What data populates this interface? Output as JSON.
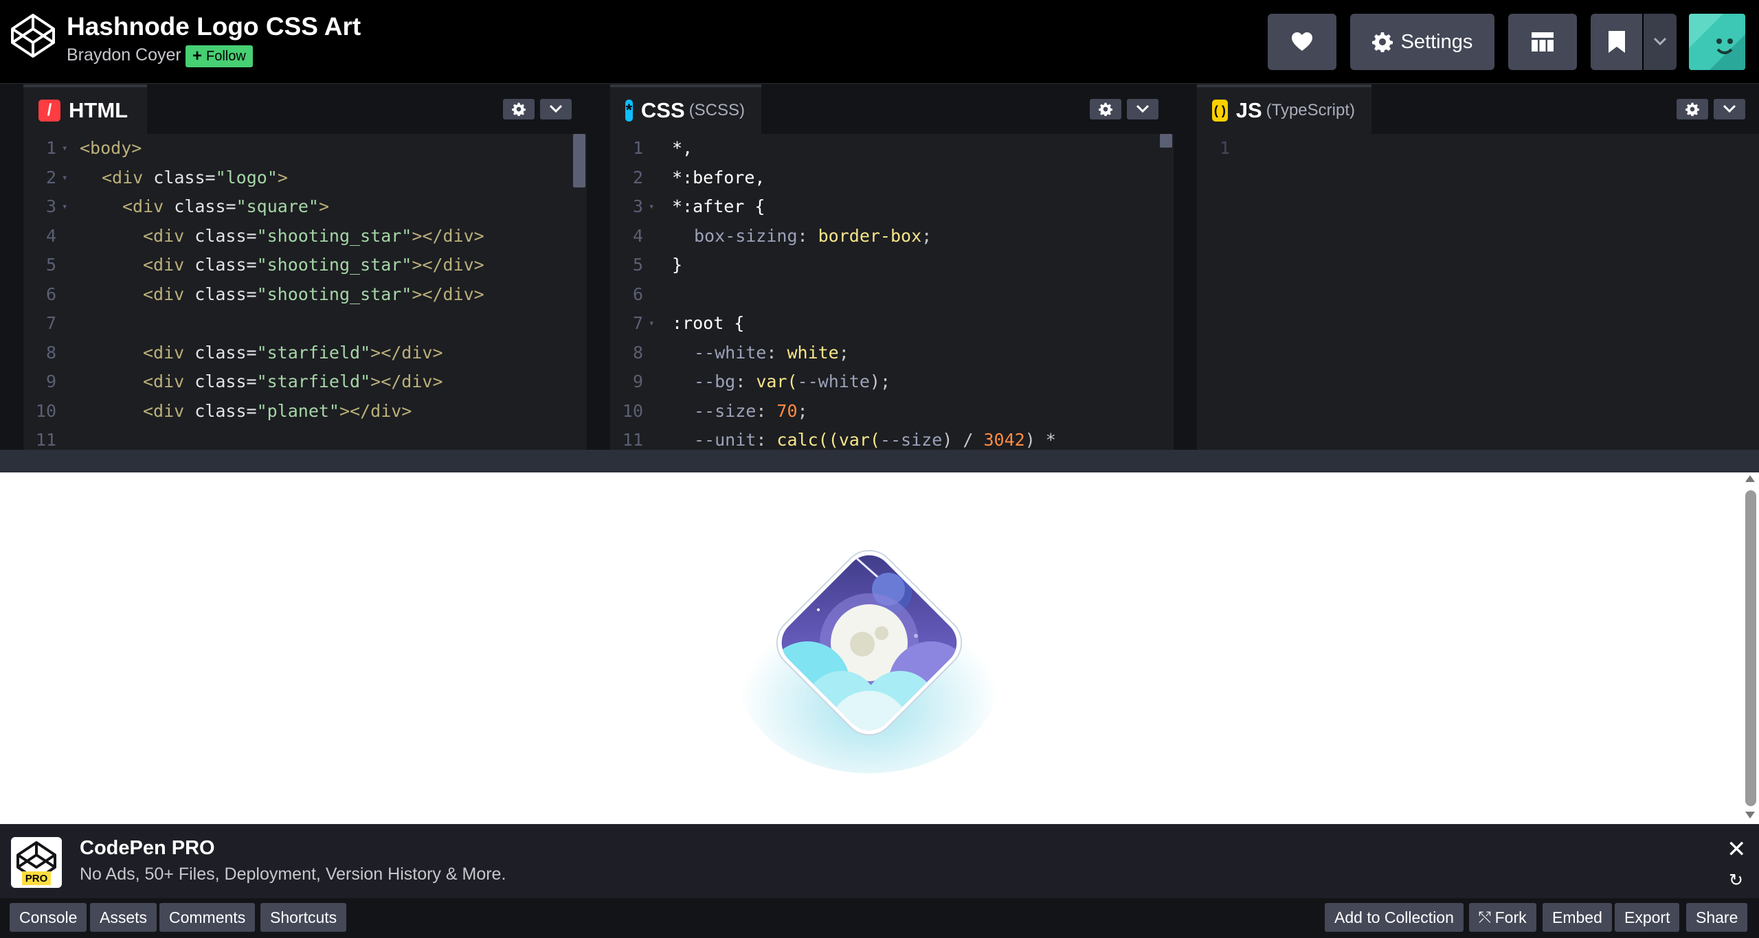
{
  "header": {
    "title": "Hashnode Logo CSS Art",
    "author": "Braydon Coyer",
    "follow_label": "Follow",
    "settings_label": "Settings"
  },
  "editors": {
    "html": {
      "label": "HTML",
      "icon_glyph": "/",
      "lines": [
        {
          "n": "1",
          "fold": true
        },
        {
          "n": "2",
          "fold": true
        },
        {
          "n": "3",
          "fold": true
        },
        {
          "n": "4"
        },
        {
          "n": "5"
        },
        {
          "n": "6"
        },
        {
          "n": "7"
        },
        {
          "n": "8"
        },
        {
          "n": "9"
        },
        {
          "n": "10"
        },
        {
          "n": "11"
        }
      ],
      "code": {
        "l1": "<body>",
        "l2_tag": "<div ",
        "l2_attr": "class=",
        "l2_str": "\"logo\"",
        "l2_end": ">",
        "l3_tag": "<div ",
        "l3_attr": "class=",
        "l3_str": "\"square\"",
        "l3_end": ">",
        "ss_tag": "<div ",
        "ss_attr": "class=",
        "ss_str": "\"shooting_star\"",
        "ss_end": "></div>",
        "sf_str": "\"starfield\"",
        "pl_str": "\"planet\""
      }
    },
    "css": {
      "label": "CSS",
      "sublabel": "(SCSS)",
      "icon_glyph": "*",
      "code": {
        "l1": "*,",
        "l2": "*:before,",
        "l3": "*:after {",
        "l4_prop": "box-sizing",
        "l4_val": "border-box",
        "l5": "}",
        "l7": ":root {",
        "l8_prop": "--white",
        "l8_val": "white",
        "l9_prop": "--bg",
        "l9_val": "var(",
        "l9_ref": "--white",
        "l9_end": ");",
        "l10_prop": "--size",
        "l10_val": "70",
        "l11_prop": "--unit",
        "l11_val": "calc((var(",
        "l11_ref": "--size",
        "l11_mid": ") / ",
        "l11_num": "3042",
        "l11_end": ") *"
      }
    },
    "js": {
      "label": "JS",
      "sublabel": "(TypeScript)",
      "icon_glyph": "( )",
      "code": {
        "l1_num": "1"
      }
    }
  },
  "pro_banner": {
    "title": "CodePen PRO",
    "subtitle": "No Ads, 50+ Files, Deployment, Version History & More.",
    "badge": "PRO",
    "close_glyph": "✕",
    "refresh_glyph": "↻"
  },
  "bottom_bar": {
    "left": [
      "Console",
      "Assets",
      "Comments",
      "Shortcuts"
    ],
    "right": [
      "Add to Collection",
      "Fork",
      "Embed",
      "Export",
      "Share"
    ]
  },
  "colors": {
    "accent_follow": "#47cf73",
    "html_icon": "#ff3c41",
    "css_icon": "#0ebeff",
    "js_icon": "#fcd000"
  }
}
